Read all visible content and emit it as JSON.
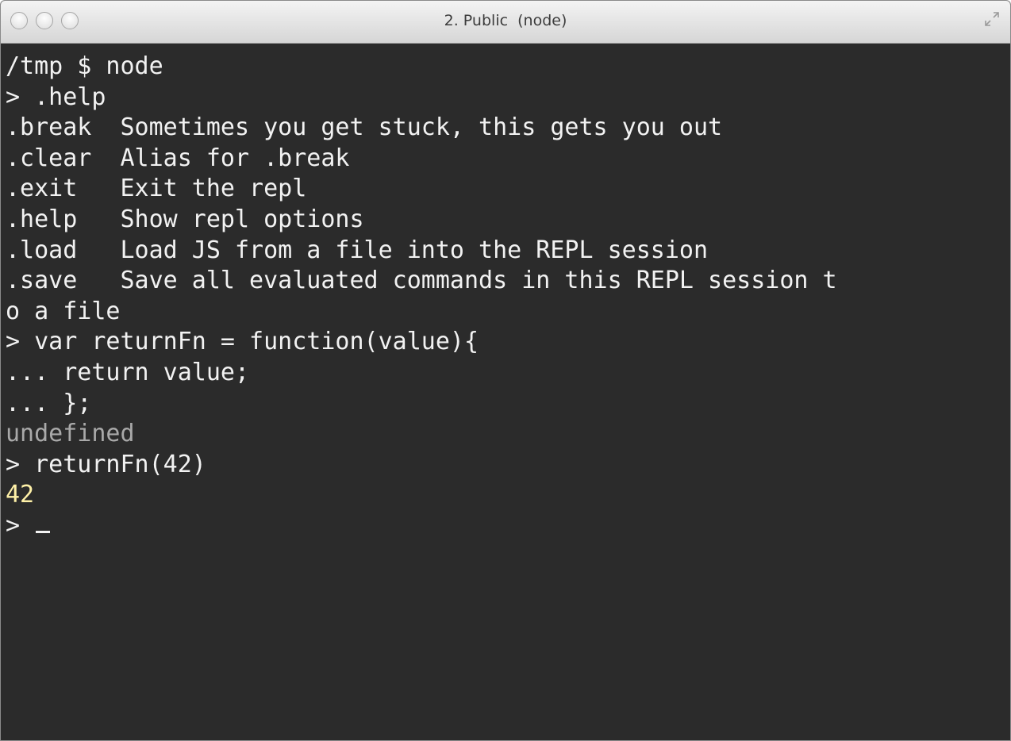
{
  "window": {
    "title": "2. Public  (node)"
  },
  "icons": {
    "close": "close-button-icon",
    "minimize": "minimize-button-icon",
    "zoom": "zoom-button-icon",
    "fullscreen": "fullscreen-arrows-icon"
  },
  "terminal": {
    "lines": [
      "/tmp $ node",
      "> .help",
      ".break  Sometimes you get stuck, this gets you out",
      ".clear  Alias for .break",
      ".exit   Exit the repl",
      ".help   Show repl options",
      ".load   Load JS from a file into the REPL session",
      ".save   Save all evaluated commands in this REPL session t",
      "o a file",
      "> var returnFn = function(value){",
      "... return value;",
      "... };",
      "undefined",
      "> returnFn(42)",
      "42",
      "> "
    ]
  },
  "colors": {
    "background": "#2b2b2b",
    "foreground": "#f2f2f2",
    "undefined_text": "#a9a9a9",
    "number_text": "#fff1a8"
  }
}
